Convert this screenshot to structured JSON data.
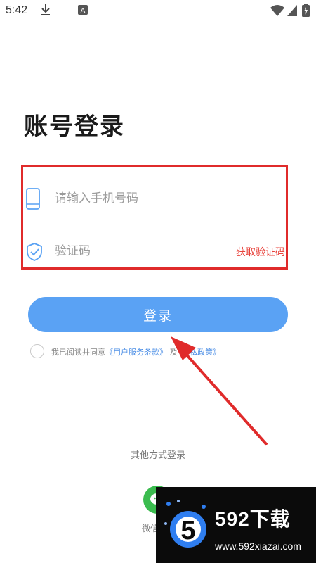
{
  "status_bar": {
    "time": "5:42",
    "icons": [
      "download-icon",
      "keyboard-a-icon",
      "wifi-icon",
      "signal-icon",
      "battery-icon"
    ]
  },
  "page": {
    "title": "账号登录"
  },
  "form": {
    "phone_placeholder": "请输入手机号码",
    "code_placeholder": "验证码",
    "get_code_label": "获取验证码",
    "phone_icon": "phone-icon",
    "code_icon": "shield-check-icon",
    "highlight_color": "#e02b2b"
  },
  "login": {
    "button_label": "登录",
    "button_color": "#5aa2f4"
  },
  "agreement": {
    "prefix": "我已阅读并同意",
    "terms_link": "《用户服务条款》",
    "and": "及",
    "privacy_link": "私政策》"
  },
  "other_login": {
    "label": "其他方式登录",
    "wechat_label": "微信",
    "wechat_icon": "wechat-icon"
  },
  "watermark": {
    "brand": "592下载",
    "url": "www.592xiazai.com"
  }
}
